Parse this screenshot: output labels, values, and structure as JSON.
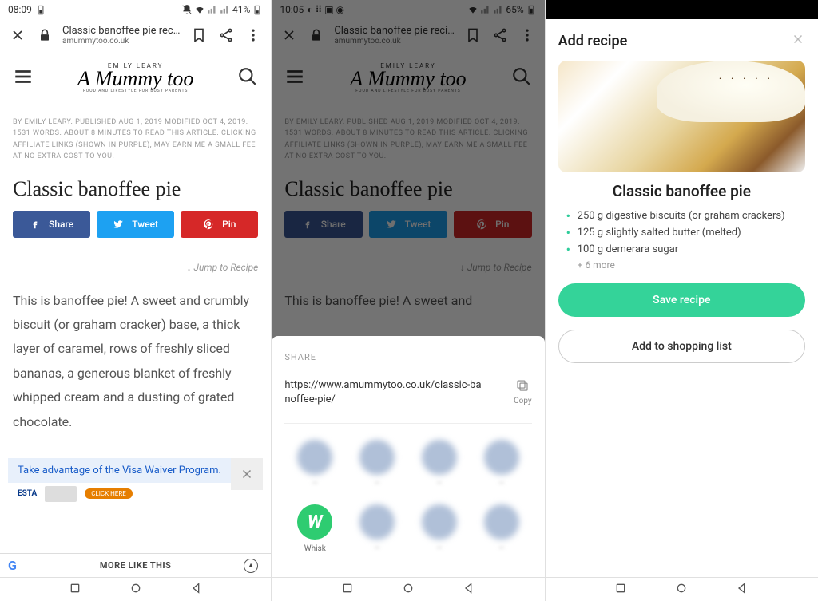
{
  "phone1": {
    "status": {
      "time": "08:09",
      "battery": "41%"
    },
    "tab": {
      "title": "Classic banoffee pie reci…",
      "domain": "amummytoo.co.uk"
    },
    "logo": {
      "sub": "EMILY LEARY",
      "main": "A Mummy too",
      "tag": "FOOD AND LIFESTYLE FOR BUSY PARENTS"
    },
    "meta": "BY EMILY LEARY. PUBLISHED AUG 1, 2019 MODIFIED OCT 4, 2019. 1531 WORDS. ABOUT 8 MINUTES TO READ THIS ARTICLE. CLICKING AFFILIATE LINKS (SHOWN IN PURPLE), MAY EARN ME A SMALL FEE AT NO EXTRA COST TO YOU.",
    "title": "Classic banoffee pie",
    "share": {
      "fb": "Share",
      "tw": "Tweet",
      "pin": "Pin"
    },
    "jump": "Jump to Recipe",
    "body": "This is banoffee pie! A sweet and crumbly biscuit (or graham cracker) base, a thick layer of caramel, rows of freshly sliced bananas, a generous blanket of freshly whipped cream and a dusting of grated chocolate.",
    "ad": {
      "headline": "Take advantage of the Visa Waiver Program.",
      "cta": "CLICK HERE"
    },
    "more": "MORE LIKE THIS"
  },
  "phone2": {
    "status": {
      "time": "10:05",
      "battery": "65%"
    },
    "tab": {
      "title": "Classic banoffee pie reci…",
      "domain": "amummytoo.co.uk"
    },
    "meta": "BY EMILY LEARY. PUBLISHED AUG 1, 2019 MODIFIED OCT 4, 2019. 1531 WORDS. ABOUT 8 MINUTES TO READ THIS ARTICLE. CLICKING AFFILIATE LINKS (SHOWN IN PURPLE), MAY EARN ME A SMALL FEE AT NO EXTRA COST TO YOU.",
    "title": "Classic banoffee pie",
    "jump": "Jump to Recipe",
    "body": "This is banoffee pie! A sweet and",
    "sheet": {
      "label": "SHARE",
      "url": "https://www.amummytoo.co.uk/classic-banoffee-pie/",
      "copy": "Copy",
      "apps": [
        {
          "name": "contact1",
          "blur": true
        },
        {
          "name": "contact2",
          "blur": true
        },
        {
          "name": "contact3",
          "blur": true
        },
        {
          "name": "contact4",
          "blur": true
        },
        {
          "name": "Whisk",
          "blur": false,
          "color": "#2ecc71",
          "glyph": "W"
        },
        {
          "name": "Slack",
          "blur": true
        },
        {
          "name": "Gmail",
          "blur": true
        },
        {
          "name": "Twitter",
          "blur": true
        }
      ]
    }
  },
  "phone3": {
    "modal": {
      "title": "Add recipe",
      "recipe_title": "Classic banoffee pie",
      "ingredients": [
        "250 g digestive biscuits (or graham crackers)",
        "125 g slightly salted butter (melted)",
        "100 g demerara sugar"
      ],
      "more": "+ 6 more",
      "save": "Save recipe",
      "add": "Add to shopping list"
    }
  }
}
